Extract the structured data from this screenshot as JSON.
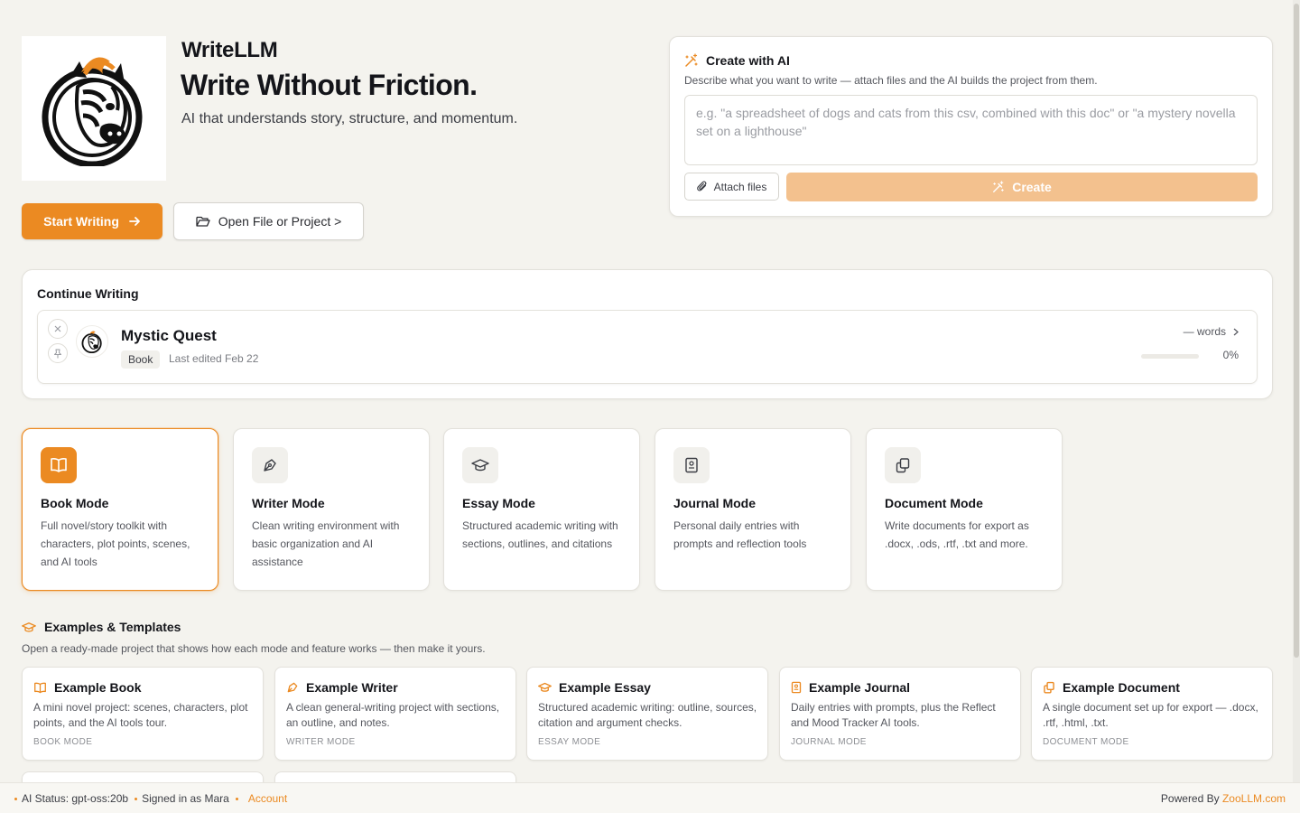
{
  "app": {
    "name": "WriteLLM",
    "tagline": "Write Without Friction.",
    "subtagline": "AI that understands story, structure, and momentum.",
    "logo_icon": "zebra-logo",
    "accent_color": "#eb8a22"
  },
  "hero": {
    "start_label": "Start Writing",
    "open_label": "Open File or Project >"
  },
  "create_ai": {
    "title": "Create with AI",
    "description": "Describe what you want to write — attach files and the AI builds the project from them.",
    "placeholder": "e.g. \"a spreadsheet of dogs and cats from this csv, combined with this doc\" or \"a mystery novella set on a lighthouse\"",
    "attach_label": "Attach files",
    "create_label": "Create"
  },
  "continue_writing": {
    "title": "Continue Writing",
    "projects": [
      {
        "name": "Mystic Quest",
        "type": "Book",
        "edited": "Last edited Feb 22",
        "words": "— words",
        "percent": "0%",
        "progress": 0
      }
    ]
  },
  "modes": [
    {
      "title": "Book Mode",
      "desc": "Full novel/story toolkit with characters, plot points, scenes, and AI tools",
      "icon": "book-icon",
      "active": true
    },
    {
      "title": "Writer Mode",
      "desc": "Clean writing environment with basic organization and AI assistance",
      "icon": "pen-icon",
      "active": false
    },
    {
      "title": "Essay Mode",
      "desc": "Structured academic writing with sections, outlines, and citations",
      "icon": "graduation-cap-icon",
      "active": false
    },
    {
      "title": "Journal Mode",
      "desc": "Personal daily entries with prompts and reflection tools",
      "icon": "journal-icon",
      "active": false
    },
    {
      "title": "Document Mode",
      "desc": "Write documents for export as .docx, .ods, .rtf, .txt and more.",
      "icon": "documents-icon",
      "active": false
    }
  ],
  "examples": {
    "title": "Examples & Templates",
    "subtitle": "Open a ready-made project that shows how each mode and feature works — then make it yours.",
    "items": [
      {
        "title": "Example Book",
        "desc": "A mini novel project: scenes, characters, plot points, and the AI tools tour.",
        "mode": "BOOK MODE",
        "icon": "book-icon"
      },
      {
        "title": "Example Writer",
        "desc": "A clean general-writing project with sections, an outline, and notes.",
        "mode": "WRITER MODE",
        "icon": "pen-icon"
      },
      {
        "title": "Example Essay",
        "desc": "Structured academic writing: outline, sources, citation and argument checks.",
        "mode": "ESSAY MODE",
        "icon": "graduation-cap-icon"
      },
      {
        "title": "Example Journal",
        "desc": "Daily entries with prompts, plus the Reflect and Mood Tracker AI tools.",
        "mode": "JOURNAL MODE",
        "icon": "journal-icon"
      },
      {
        "title": "Example Document",
        "desc": "A single document set up for export — .docx, .rtf, .html, .txt.",
        "mode": "DOCUMENT MODE",
        "icon": "documents-icon"
      }
    ]
  },
  "footer": {
    "ai_status": "AI Status: gpt-oss:20b",
    "signed_in": "Signed in as Mara",
    "account": "Account",
    "powered_prefix": "Powered By ",
    "powered_brand": "ZooLLM.com"
  }
}
